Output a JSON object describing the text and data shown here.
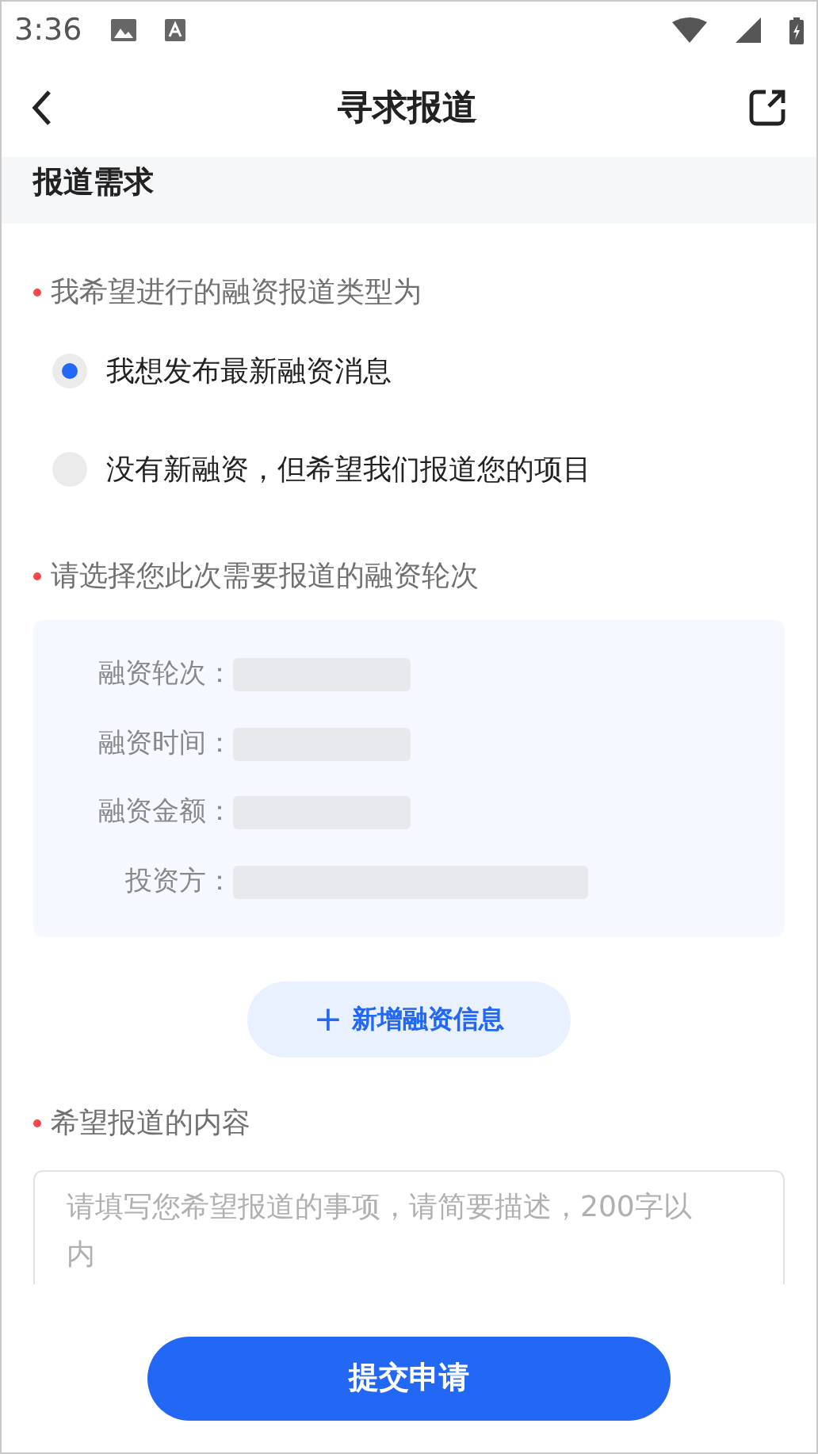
{
  "status_bar": {
    "time": "3:36"
  },
  "nav": {
    "title": "寻求报道"
  },
  "section": {
    "title": "报道需求"
  },
  "type_question": {
    "label": "我希望进行的融资报道类型为",
    "options": [
      {
        "label": "我想发布最新融资消息",
        "selected": true
      },
      {
        "label": "没有新融资，但希望我们报道您的项目",
        "selected": false
      }
    ]
  },
  "round_question": {
    "label": "请选择您此次需要报道的融资轮次",
    "fields": [
      {
        "label": "融资轮次：",
        "kind": "short"
      },
      {
        "label": "融资时间：",
        "kind": "short"
      },
      {
        "label": "融资金额：",
        "kind": "short"
      },
      {
        "label": "投资方：",
        "kind": "long"
      }
    ],
    "add_button": {
      "icon": "+",
      "label": "新增融资信息"
    }
  },
  "content_question": {
    "label": "希望报道的内容",
    "placeholder": "请填写您希望报道的事项，请简要描述，200字以内"
  },
  "submit_button": {
    "label": "提交申请"
  }
}
